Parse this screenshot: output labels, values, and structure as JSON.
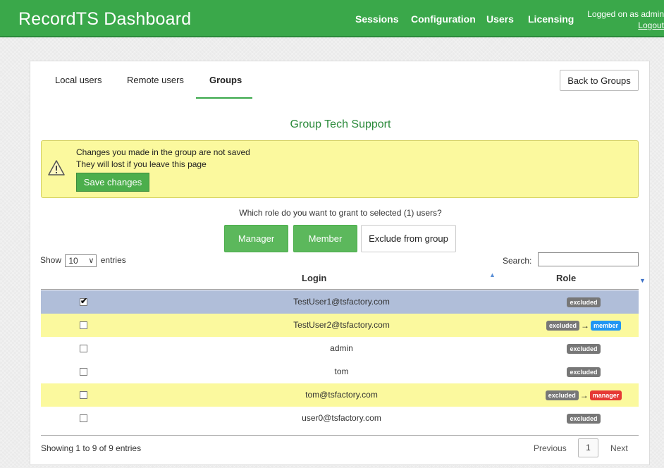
{
  "header": {
    "brand": "RecordTS Dashboard",
    "nav": [
      "Sessions",
      "Configuration",
      "Users",
      "Licensing"
    ],
    "logged_text": "Logged on as admin",
    "logout_label": "Logout"
  },
  "tabs": [
    "Local users",
    "Remote users",
    "Groups"
  ],
  "active_tab": "Groups",
  "back_label": "Back to Groups",
  "group_title": "Group Tech Support",
  "warning": {
    "line1": "Changes you made in the group are not saved",
    "line2": "They will lost if you leave this page",
    "save_label": "Save changes"
  },
  "role_question": "Which role do you want to grant to selected (1) users?",
  "role_buttons": {
    "manager": "Manager",
    "member": "Member",
    "exclude": "Exclude from group"
  },
  "entries": {
    "show": "Show",
    "value": "10",
    "suffix": "entries"
  },
  "search_label": "Search:",
  "columns": {
    "login": "Login",
    "role": "Role"
  },
  "rows": [
    {
      "login": "TestUser1@tsfactory.com",
      "checked": true,
      "from": "excluded",
      "to": ""
    },
    {
      "login": "TestUser2@tsfactory.com",
      "checked": false,
      "from": "excluded",
      "to": "member"
    },
    {
      "login": "admin",
      "checked": false,
      "from": "excluded",
      "to": ""
    },
    {
      "login": "tom",
      "checked": false,
      "from": "excluded",
      "to": ""
    },
    {
      "login": "tom@tsfactory.com",
      "checked": false,
      "from": "excluded",
      "to": "manager"
    },
    {
      "login": "user0@tsfactory.com",
      "checked": false,
      "from": "excluded",
      "to": ""
    }
  ],
  "footer": {
    "showing": "Showing 1 to 9 of 9 entries",
    "prev": "Previous",
    "page": "1",
    "next": "Next"
  },
  "colors": {
    "brand_green": "#3aa84a",
    "button_green": "#5cb85c",
    "warning_bg": "#fbf99e",
    "selected_row": "#b0bed9"
  }
}
